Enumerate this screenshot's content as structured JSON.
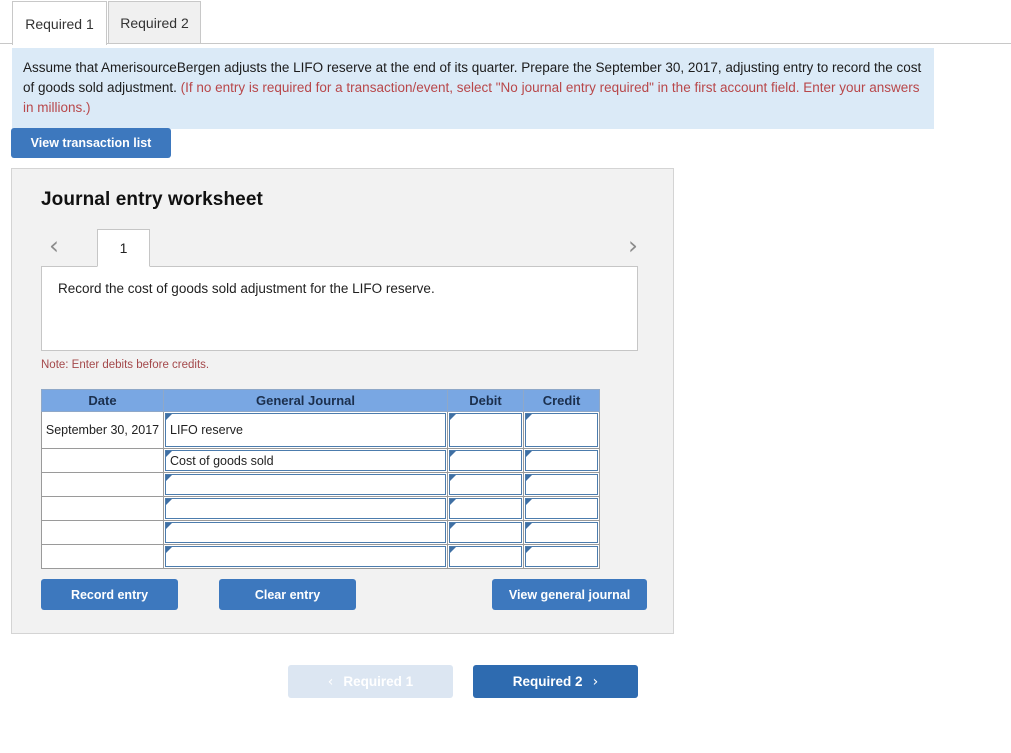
{
  "tabs": [
    {
      "label": "Required 1",
      "active": true
    },
    {
      "label": "Required 2",
      "active": false
    }
  ],
  "banner": {
    "text_main": "Assume that AmerisourceBergen adjusts the LIFO reserve at the end of its quarter. Prepare the September 30, 2017, adjusting entry to record the cost of goods sold adjustment. ",
    "text_hint": "(If no entry is required for a transaction/event, select \"No journal entry required\" in the first account field. Enter your answers in millions.)"
  },
  "toolbar": {
    "view_transaction_list_label": "View transaction list"
  },
  "worksheet": {
    "title": "Journal entry worksheet",
    "pager": {
      "prev_icon": "‹",
      "next_icon": "›",
      "current_page": "1"
    },
    "description": "Record the cost of goods sold adjustment for the LIFO reserve.",
    "note": "Note: Enter debits before credits.",
    "table": {
      "headers": [
        "Date",
        "General Journal",
        "Debit",
        "Credit"
      ],
      "rows": [
        {
          "date": "September 30, 2017",
          "account": "LIFO reserve",
          "debit": "",
          "credit": ""
        },
        {
          "date": "",
          "account": "Cost of goods sold",
          "debit": "",
          "credit": ""
        },
        {
          "date": "",
          "account": "",
          "debit": "",
          "credit": ""
        },
        {
          "date": "",
          "account": "",
          "debit": "",
          "credit": ""
        },
        {
          "date": "",
          "account": "",
          "debit": "",
          "credit": ""
        },
        {
          "date": "",
          "account": "",
          "debit": "",
          "credit": ""
        }
      ]
    },
    "actions": {
      "record_entry_label": "Record entry",
      "clear_entry_label": "Clear entry",
      "view_general_journal_label": "View general journal"
    }
  },
  "bottom_nav": {
    "prev_label": "Required 1",
    "prev_icon": "‹",
    "next_label": "Required 2",
    "next_icon": "›"
  },
  "colors": {
    "primary_blue": "#3d78be",
    "nav_blue": "#2e6bb0",
    "nav_disabled": "#dce6f2",
    "table_header_blue": "#79a7e3",
    "banner_blue": "#dbeaf7",
    "hint_red": "#b8474a",
    "note_red": "#a4494b",
    "panel_gray": "#f2f2f2"
  }
}
